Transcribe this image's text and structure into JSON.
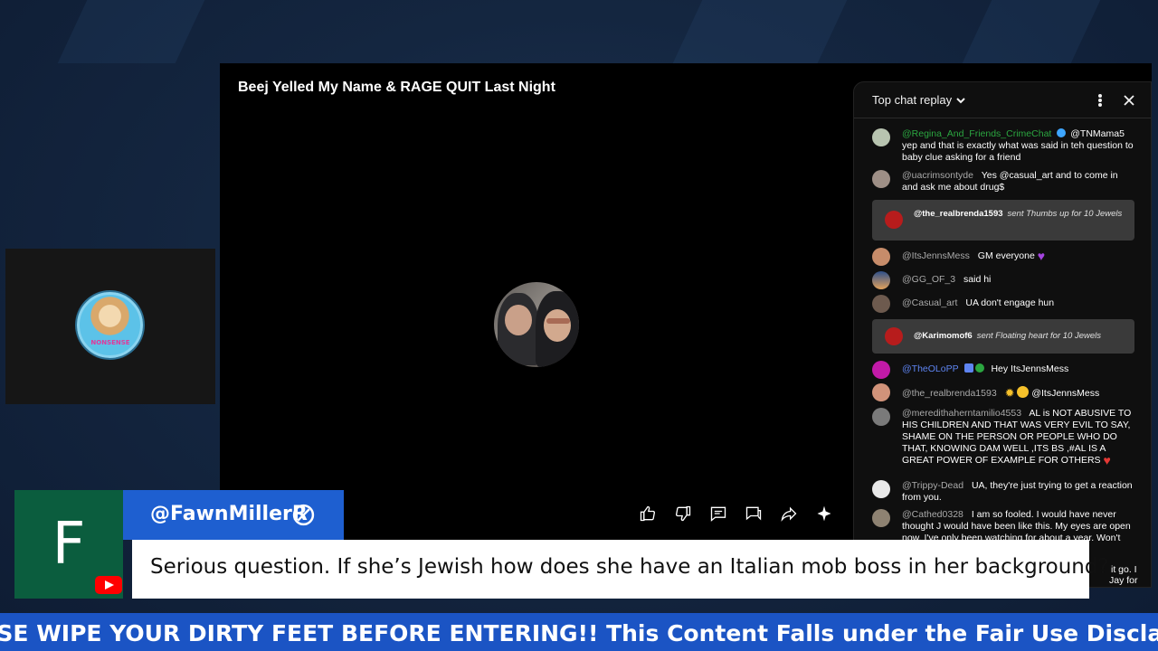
{
  "video": {
    "title": "Beej Yelled My Name & RAGE QUIT Last Night"
  },
  "webcam": {
    "avatar_text": "NONSENSE"
  },
  "chat": {
    "mode_label": "Top chat replay",
    "messages": [
      {
        "author": "@Regina_And_Friends_CrimeChat",
        "mention": "@TNMama5",
        "text": "yep and that is exactly what was said in teh question to baby clue asking for a friend"
      },
      {
        "author": "@uacrimsontyde",
        "text": "Yes @casual_art and to come in and ask me about drug$"
      },
      {
        "author": "@ItsJennsMess",
        "text": "GM everyone"
      },
      {
        "author": "@GG_OF_3",
        "text": "said hi"
      },
      {
        "author": "@Casual_art",
        "text": "UA don't engage hun"
      },
      {
        "author": "@TheOLoPP",
        "text": "Hey ItsJennsMess"
      },
      {
        "author": "@the_realbrenda1593",
        "text": "@ItsJennsMess"
      },
      {
        "author": "@meredithaherntamilio4553",
        "text": "AL is NOT ABUSIVE TO HIS CHILDREN AND THAT WAS VERY EVIL TO SAY, SHAME ON THE PERSON OR PEOPLE WHO DO THAT, KNOWING DAM WELL ,ITS BS ,#AL IS A GREAT POWER OF EXAMPLE FOR OTHERS"
      },
      {
        "author": "@Trippy-Dead",
        "text": "UA, they're just trying to get a reaction from you."
      },
      {
        "author": "@Cathed0328",
        "text": "I am so fooled. I would have never thought J would have been like this. My eyes are open now. I've only been watching for about a year. Won't"
      }
    ],
    "gifts": [
      {
        "author": "@the_realbrenda1593",
        "text": "sent Thumbs up for 10 Jewels"
      },
      {
        "author": "@Karimomof6",
        "text": "sent Floating heart for 10 Jewels"
      }
    ],
    "overflow_fragments": [
      "it go. I",
      "Jay for"
    ]
  },
  "lower_third": {
    "initial": "F",
    "username": "@FawnMillerR",
    "message": "Serious question. If she’s Jewish how does she have an Italian mob boss in her background?"
  },
  "ticker": {
    "text": "EASE WIPE YOUR DIRTY FEET BEFORE ENTERING!! This Content Falls under the Fair Use Disclaimer and is"
  },
  "colors": {
    "brand_blue": "#1e5fd0",
    "ticker_blue": "#1b54c4",
    "lower_third_green": "#0b5d3e",
    "youtube_red": "#ff0000",
    "chat_author_green": "#2ba640"
  },
  "icons": {
    "actions": [
      "thumbs-up-icon",
      "thumbs-down-icon",
      "comment-icon",
      "chat-icon",
      "share-icon",
      "sparkle-icon"
    ],
    "chat_header": [
      "more-vert-icon",
      "close-icon"
    ]
  }
}
